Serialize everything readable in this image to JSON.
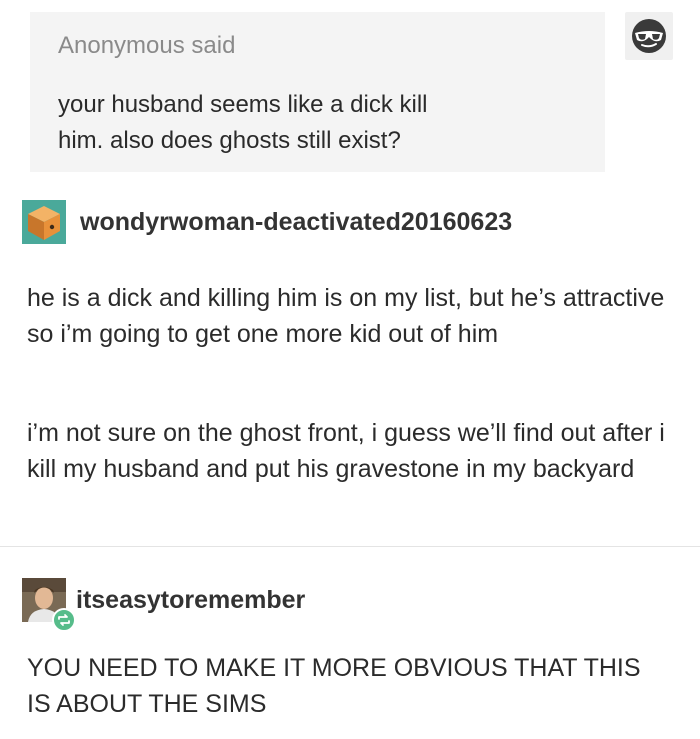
{
  "ask": {
    "author": "Anonymous said",
    "question_lines": [
      "your husband seems like a dick kill",
      "him. also does ghosts still exist?"
    ],
    "avatar_icon": "anonymous-sunglasses-icon"
  },
  "reblogs": [
    {
      "username": "wondyrwoman-deactivated20160623",
      "avatar_icon": "cube-avatar-icon",
      "paragraphs": [
        "he is a dick and killing him is on my list, but he’s attractive so i’m going to get one more kid out of him",
        "i’m not sure on the ghost front, i guess we’ll find out after i kill my husband and put his gravestone in my backyard"
      ]
    },
    {
      "username": "itseasytoremember",
      "avatar_icon": "user-photo-avatar",
      "badge_icon": "reblog-icon",
      "paragraphs": [
        "YOU NEED TO MAKE IT MORE OBVIOUS THAT THIS IS ABOUT THE SIMS"
      ]
    }
  ],
  "colors": {
    "ask_background": "#f4f4f4",
    "reblog_badge": "#56bc8a",
    "cube_orange": "#e8913a",
    "cube_teal": "#4aa99a"
  }
}
